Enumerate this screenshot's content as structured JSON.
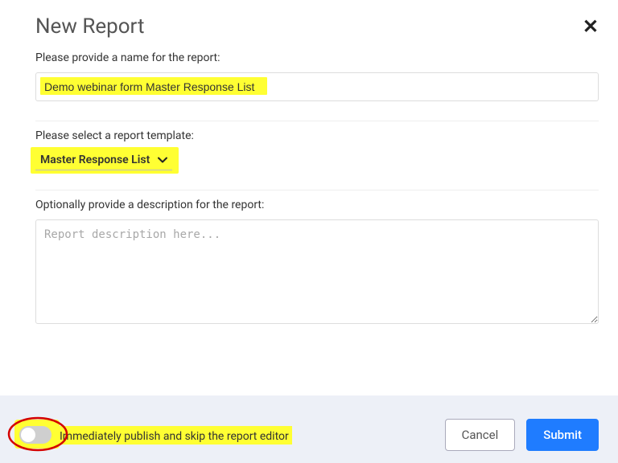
{
  "header": {
    "title": "New Report"
  },
  "name_section": {
    "label": "Please provide a name for the report:",
    "value": "Demo webinar form Master Response List"
  },
  "template_section": {
    "label": "Please select a report template:",
    "selected": "Master Response List"
  },
  "description_section": {
    "label": "Optionally provide a description for the report:",
    "placeholder": "Report description here..."
  },
  "toggle": {
    "label": "Immediately publish and skip the report editor",
    "on": false
  },
  "actions": {
    "cancel": "Cancel",
    "submit": "Submit"
  }
}
